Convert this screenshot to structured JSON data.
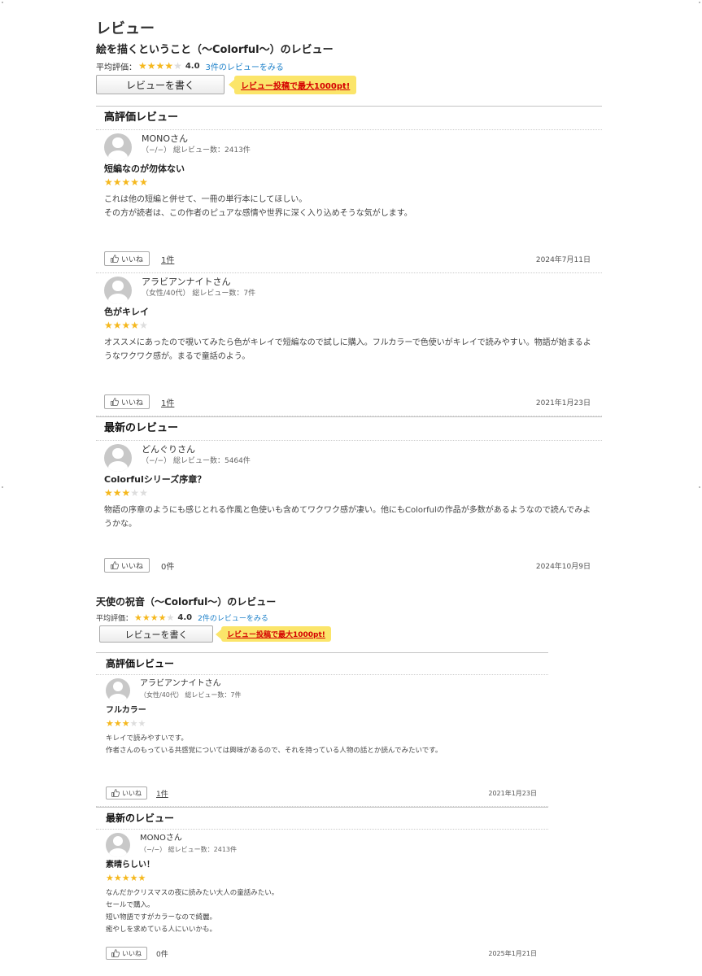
{
  "page_title": "レビュー",
  "labels": {
    "avg_rating": "平均評価：",
    "write_review": "レビューを書く",
    "point_campaign": "レビュー投稿で最大1000pt!",
    "like": "いいね"
  },
  "colors": {
    "star_filled": "#f5b81e",
    "star_empty": "#dddddd",
    "link": "#1a7fc9",
    "badge_bg": "#fbe56a",
    "badge_text": "#d40000"
  },
  "books": [
    {
      "title": "絵を描くということ（〜Colorful〜）のレビュー",
      "avg": {
        "value": "4.0",
        "stars": 4
      },
      "all_reviews_link": "3件のレビューをみる",
      "sections": [
        {
          "heading": "高評価レビュー",
          "reviews": [
            {
              "name": "MONOさん",
              "meta": "（−/−） 総レビュー数：2413件",
              "title": "短編なのが勿体ない",
              "stars": 5,
              "body": [
                "これは他の短編と併せて、一冊の単行本にしてほしい。",
                "その方が読者は、この作者のピュアな感情や世界に深く入り込めそうな気がします。"
              ],
              "likes": "1件",
              "date": "2024年7月11日"
            },
            {
              "name": "アラビアンナイトさん",
              "meta": "（女性/40代） 総レビュー数：7件",
              "title": "色がキレイ",
              "stars": 4,
              "body": [
                "オススメにあったので覗いてみたら色がキレイで短編なので試しに購入。フルカラーで色使いがキレイで読みやすい。物語が始まるようなワクワク感が。まるで童話のよう。"
              ],
              "likes": "1件",
              "date": "2021年1月23日"
            }
          ]
        },
        {
          "heading": "最新のレビュー",
          "reviews": [
            {
              "name": "どんぐりさん",
              "meta": "（−/−） 総レビュー数：5464件",
              "title": "Colorfulシリーズ序章？",
              "stars": 3,
              "body": [
                "物語の序章のようにも感じとれる作風と色使いも含めてワクワク感が凄い。他にもColorfulの作品が多数があるようなので読んでみようかな。"
              ],
              "likes": "0件",
              "date": "2024年10月9日"
            }
          ]
        }
      ]
    },
    {
      "title": "天使の祝音（〜Colorful〜）のレビュー",
      "avg": {
        "value": "4.0",
        "stars": 4
      },
      "all_reviews_link": "2件のレビューをみる",
      "sections": [
        {
          "heading": "高評価レビュー",
          "reviews": [
            {
              "name": "アラビアンナイトさん",
              "meta": "（女性/40代） 総レビュー数：7件",
              "title": "フルカラー",
              "stars": 3,
              "body": [
                "キレイで読みやすいです。",
                "作者さんのもっている共感覚については興味があるので、それを持っている人物の話とか読んでみたいです。"
              ],
              "likes": "1件",
              "date": "2021年1月23日"
            }
          ]
        },
        {
          "heading": "最新のレビュー",
          "reviews": [
            {
              "name": "MONOさん",
              "meta": "（−/−） 総レビュー数：2413件",
              "title": "素晴らしい！",
              "stars": 5,
              "body": [
                "なんだかクリスマスの夜に読みたい大人の童話みたい。",
                "セールで購入。",
                "短い物語ですがカラーなので綺麗。",
                "癒やしを求めている人にいいかも。"
              ],
              "likes": "0件",
              "date": "2025年1月21日"
            }
          ]
        }
      ]
    }
  ]
}
